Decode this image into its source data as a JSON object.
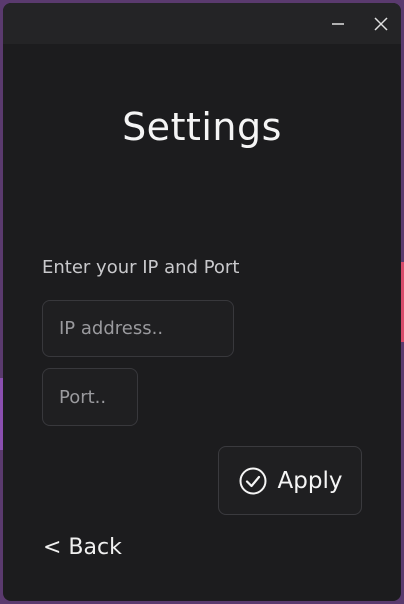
{
  "window": {
    "minimize_icon": "minimize-icon",
    "close_icon": "close-icon"
  },
  "page": {
    "title": "Settings",
    "prompt": "Enter your IP and Port"
  },
  "form": {
    "ip_placeholder": "IP address..",
    "ip_value": "",
    "port_placeholder": "Port..",
    "port_value": ""
  },
  "actions": {
    "apply_label": "Apply",
    "apply_icon": "check-circle-icon",
    "back_label": "< Back"
  },
  "colors": {
    "window_bg": "#1c1c1e",
    "titlebar_bg": "#242426",
    "field_border": "#38383c",
    "text": "#f0f0f0"
  }
}
